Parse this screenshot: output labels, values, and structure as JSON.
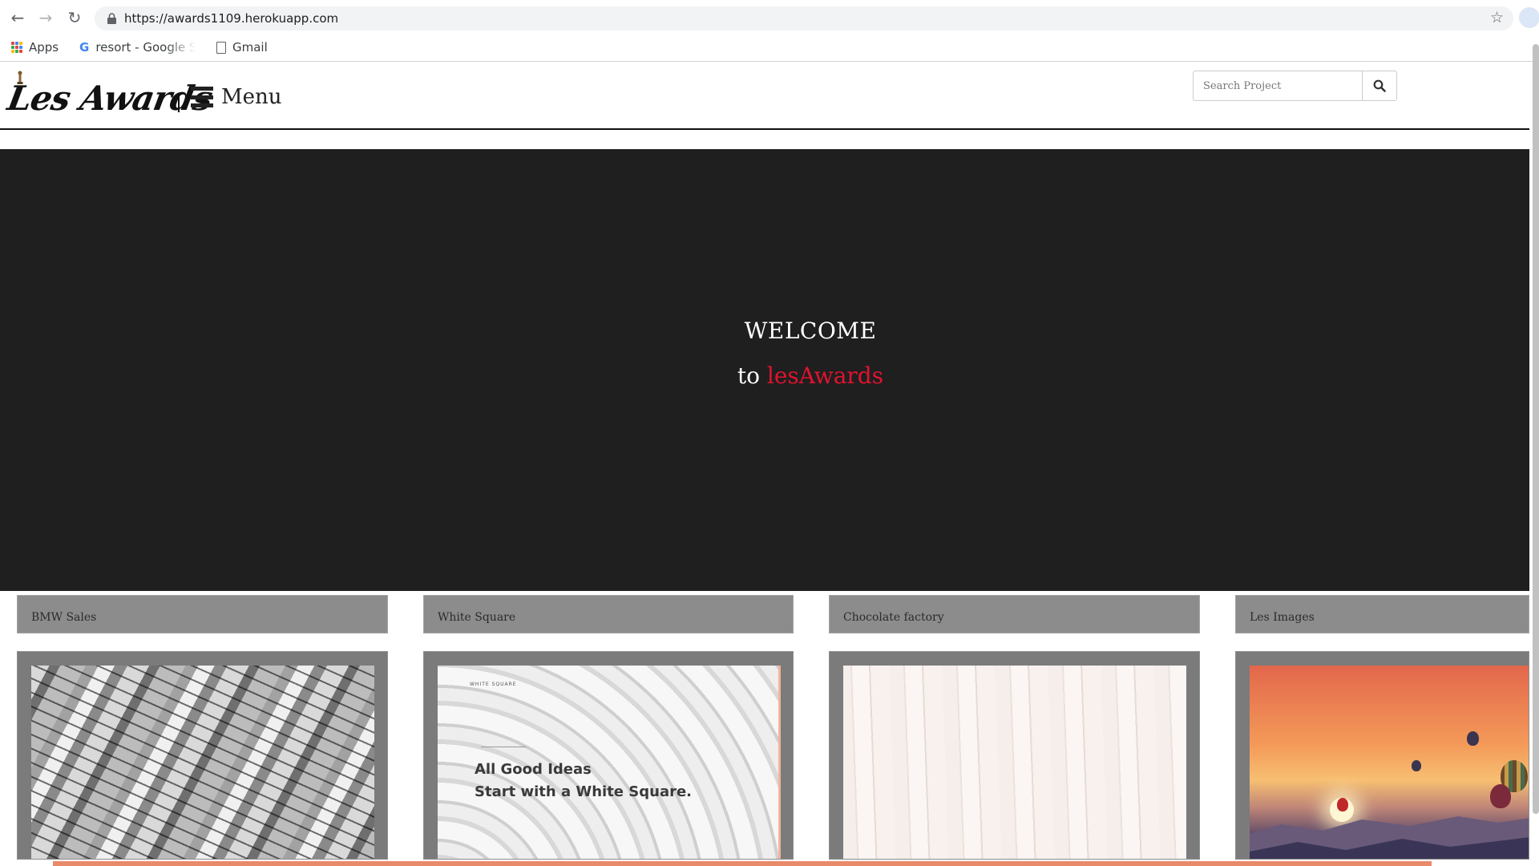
{
  "browser": {
    "url": "https://awards1109.herokuapp.com",
    "bookmarks": [
      {
        "label": "Apps",
        "icon": "apps-grid-icon"
      },
      {
        "label": "resort - Google S",
        "icon": "google-icon"
      },
      {
        "label": "Gmail",
        "icon": "document-icon"
      }
    ]
  },
  "header": {
    "logo_text": "Les Awards",
    "menu_label": "Menu",
    "search_placeholder": "Search Project"
  },
  "hero": {
    "welcome": "WELCOME",
    "tagline_prefix": "to ",
    "tagline_brand": "lesAwards"
  },
  "projects": [
    {
      "title": "BMW Sales"
    },
    {
      "title": "White Square",
      "image_text_small": "WHITE SQUARE",
      "image_text": "All Good Ideas\nStart with a White Square."
    },
    {
      "title": "Chocolate factory"
    },
    {
      "title": "Les Images"
    }
  ],
  "colors": {
    "hero_bg": "#1f1f1f",
    "brand_red": "#e1132f",
    "card_bg": "#8c8c8c"
  }
}
